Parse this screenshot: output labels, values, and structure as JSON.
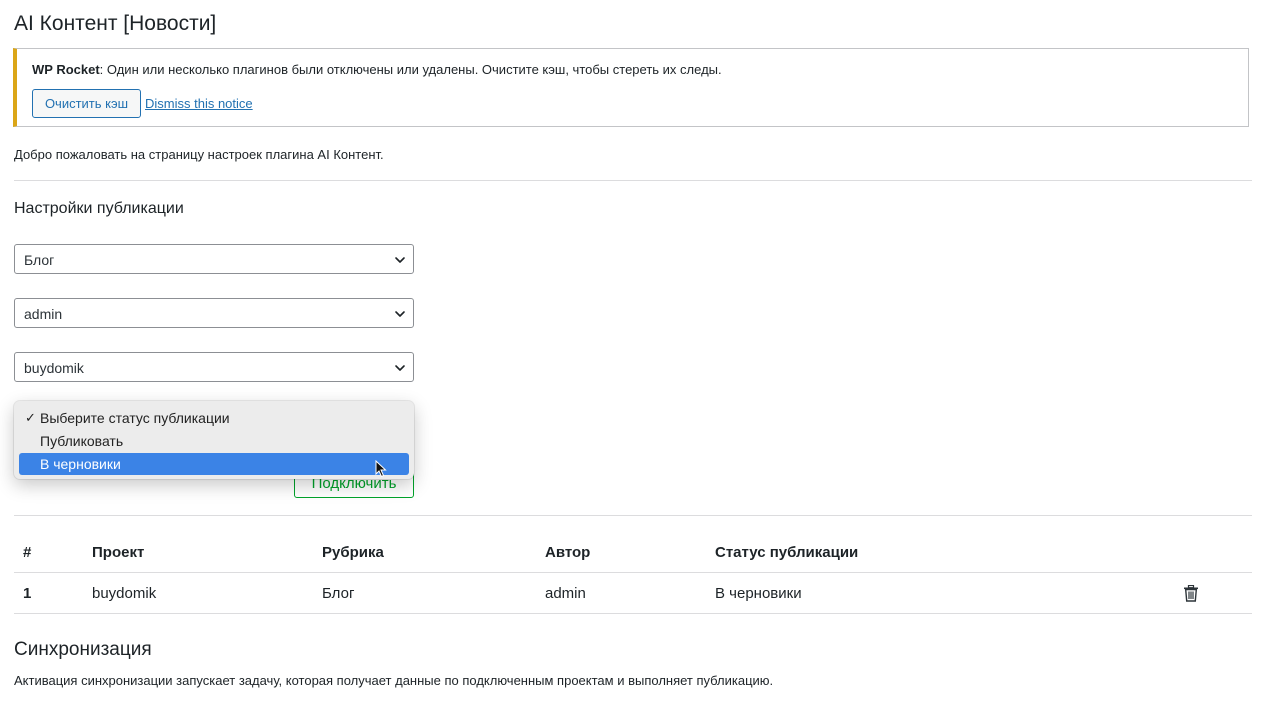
{
  "page": {
    "title": "AI Контент [Новости]"
  },
  "notice": {
    "plugin_name": "WP Rocket",
    "message": ": Один или несколько плагинов были отключены или удалены. Очистите кэш, чтобы стереть их следы.",
    "clear_button": "Очистить кэш",
    "dismiss_link": "Dismiss this notice",
    "accent_color": "#dba617"
  },
  "welcome_text": "Добро пожаловать на страницу настроек плагина AI Контент.",
  "publication_settings": {
    "title": "Настройки публикации",
    "category_select": {
      "value": "Блог"
    },
    "author_select": {
      "value": "admin"
    },
    "project_select": {
      "value": "buydomik"
    },
    "status_dropdown": {
      "options": [
        {
          "label": "Выберите статус публикации",
          "checked": true,
          "highlighted": false
        },
        {
          "label": "Публиковать",
          "checked": false,
          "highlighted": false
        },
        {
          "label": "В черновики",
          "checked": false,
          "highlighted": true
        }
      ],
      "check_glyph": "✓"
    },
    "connect_button": "Подключить"
  },
  "table": {
    "headers": [
      "#",
      "Проект",
      "Рубрика",
      "Автор",
      "Статус публикации"
    ],
    "rows": [
      {
        "num": "1",
        "project": "buydomik",
        "category": "Блог",
        "author": "admin",
        "status": "В черновики",
        "action_icon": "trash-icon"
      }
    ]
  },
  "sync": {
    "title": "Синхронизация",
    "description": "Активация синхронизации запускает задачу, которая получает данные по подключенным проектам и выполняет публикацию."
  },
  "colors": {
    "link": "#2271b1",
    "success": "#00a32a",
    "highlight": "#3b83e6"
  }
}
